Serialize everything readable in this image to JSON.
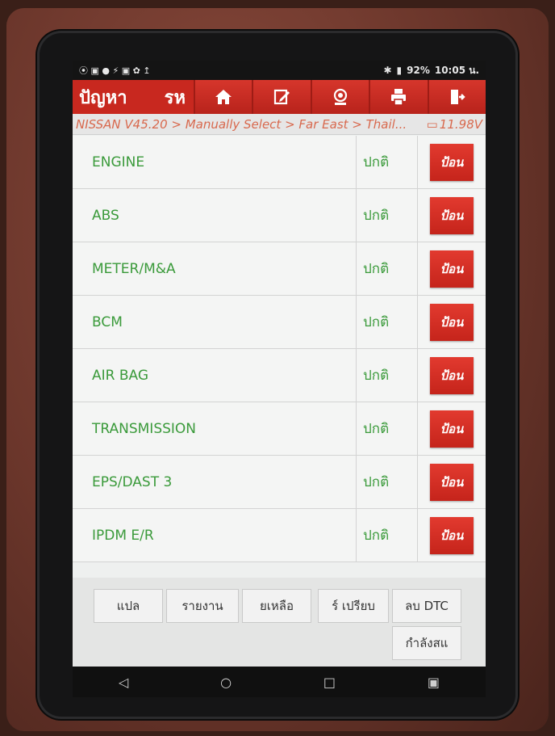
{
  "statusbar": {
    "icons_left": "⦿ ▣ ● ⚡ ▣ ✿ ↥",
    "battery": "92%",
    "time": "10:05 น."
  },
  "toolbar": {
    "title": "ปัญหา",
    "subtitle": "รห",
    "buttons": [
      "home-icon",
      "edit-icon",
      "webcam-icon",
      "print-icon",
      "exit-icon"
    ]
  },
  "breadcrumb": {
    "path": "NISSAN V45.20 > Manually Select > Far East > Thail...",
    "voltage": "11.98V"
  },
  "systems": [
    {
      "name": "ENGINE",
      "status": "ปกติ",
      "action": "ป้อน"
    },
    {
      "name": "ABS",
      "status": "ปกติ",
      "action": "ป้อน"
    },
    {
      "name": "METER/M&A",
      "status": "ปกติ",
      "action": "ป้อน"
    },
    {
      "name": "BCM",
      "status": "ปกติ",
      "action": "ป้อน"
    },
    {
      "name": "AIR BAG",
      "status": "ปกติ",
      "action": "ป้อน"
    },
    {
      "name": "TRANSMISSION",
      "status": "ปกติ",
      "action": "ป้อน"
    },
    {
      "name": "EPS/DAST 3",
      "status": "ปกติ",
      "action": "ป้อน"
    },
    {
      "name": "IPDM E/R",
      "status": "ปกติ",
      "action": "ป้อน"
    }
  ],
  "bottom": {
    "translate": "แปล",
    "report": "รายงาน",
    "remaining": "ยเหลือ",
    "compare": "ร์ เปรียบ",
    "clear_dtc": "ลบ DTC",
    "working": "กำลังสแ"
  },
  "colors": {
    "accent": "#c8281f",
    "text_green": "#3a9a3a",
    "breadcrumb": "#d8694e"
  }
}
